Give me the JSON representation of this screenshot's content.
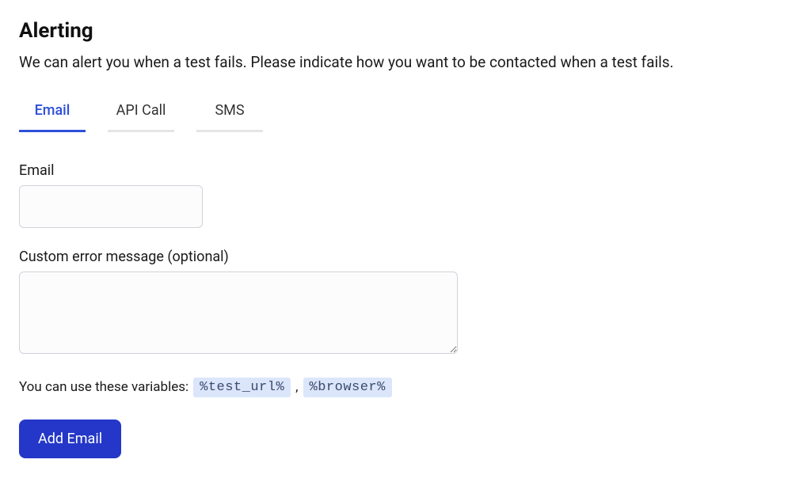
{
  "header": {
    "title": "Alerting",
    "description": "We can alert you when a test fails. Please indicate how you want to be contacted when a test fails."
  },
  "tabs": [
    {
      "id": "email",
      "label": "Email",
      "active": true
    },
    {
      "id": "api",
      "label": "API Call",
      "active": false
    },
    {
      "id": "sms",
      "label": "SMS",
      "active": false
    }
  ],
  "form": {
    "email": {
      "label": "Email",
      "value": ""
    },
    "custom_message": {
      "label": "Custom error message (optional)",
      "value": ""
    },
    "variables_hint_prefix": "You can use these variables:",
    "variables": [
      "%test_url%",
      "%browser%"
    ],
    "submit_label": "Add Email"
  }
}
